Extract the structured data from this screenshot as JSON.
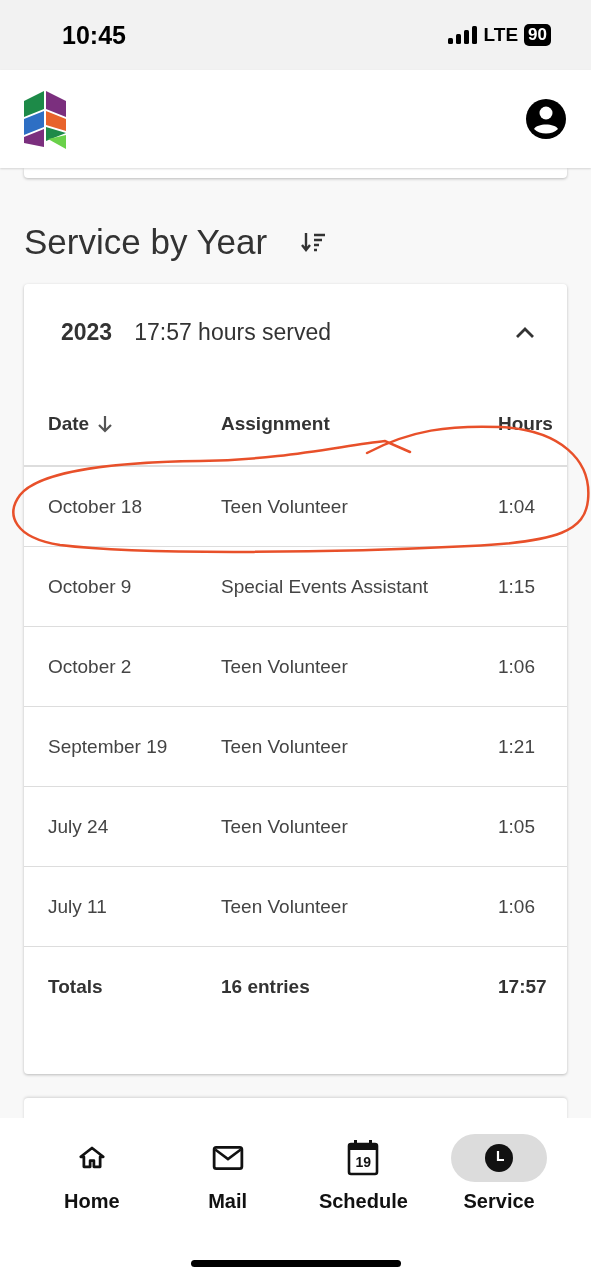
{
  "status_bar": {
    "time": "10:45",
    "network": "LTE",
    "battery": "90"
  },
  "section_title": "Service by Year",
  "year_card": {
    "year": "2023",
    "summary": "17:57 hours served",
    "expanded": true,
    "columns": [
      {
        "label": "Date",
        "sorted": true
      },
      {
        "label": "Assignment",
        "sorted": false
      },
      {
        "label": "Hours",
        "sorted": false
      }
    ],
    "rows": [
      {
        "date": "October 18",
        "assignment": "Teen Volunteer",
        "hours": "1:04"
      },
      {
        "date": "October 9",
        "assignment": "Special Events Assistant",
        "hours": "1:15"
      },
      {
        "date": "October 2",
        "assignment": "Teen Volunteer",
        "hours": "1:06"
      },
      {
        "date": "September 19",
        "assignment": "Teen Volunteer",
        "hours": "1:21"
      },
      {
        "date": "July 24",
        "assignment": "Teen Volunteer",
        "hours": "1:05"
      },
      {
        "date": "July 11",
        "assignment": "Teen Volunteer",
        "hours": "1:06"
      }
    ],
    "totals": {
      "label": "Totals",
      "entries": "16 entries",
      "hours": "17:57"
    }
  },
  "bottom_nav": [
    {
      "kind": "home",
      "label": "Home",
      "selected": false
    },
    {
      "kind": "mail",
      "label": "Mail",
      "selected": false
    },
    {
      "kind": "calendar",
      "label": "Schedule",
      "icon_text": "19",
      "selected": false
    },
    {
      "kind": "clock",
      "label": "Service",
      "selected": true
    }
  ]
}
